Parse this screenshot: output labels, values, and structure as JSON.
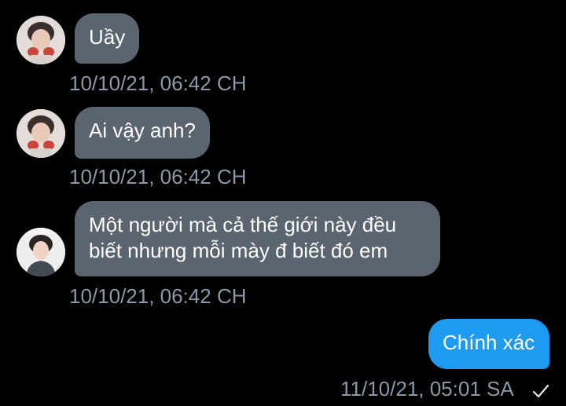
{
  "colors": {
    "background": "#000000",
    "incoming_bubble": "#5b6570",
    "outgoing_bubble": "#1d9bf0",
    "timestamp_text": "#8b98a5",
    "bubble_text": "#ffffff"
  },
  "messages": [
    {
      "direction": "incoming",
      "avatar": "contact-avatar-1",
      "text": "Uầy",
      "timestamp": "10/10/21, 06:42 CH"
    },
    {
      "direction": "incoming",
      "avatar": "contact-avatar-1",
      "text": "Ai vậy anh?",
      "timestamp": "10/10/21, 06:42 CH"
    },
    {
      "direction": "incoming",
      "avatar": "contact-avatar-2",
      "text_line1": "Một người mà cả thế giới này đều",
      "text_line2": "biết nhưng mỗi mày đ biết đó em",
      "timestamp": "10/10/21, 06:42 CH"
    },
    {
      "direction": "outgoing",
      "text": "Chính xác",
      "timestamp": "11/10/21, 05:01 SA",
      "status_icon": "sent-check-icon"
    }
  ]
}
